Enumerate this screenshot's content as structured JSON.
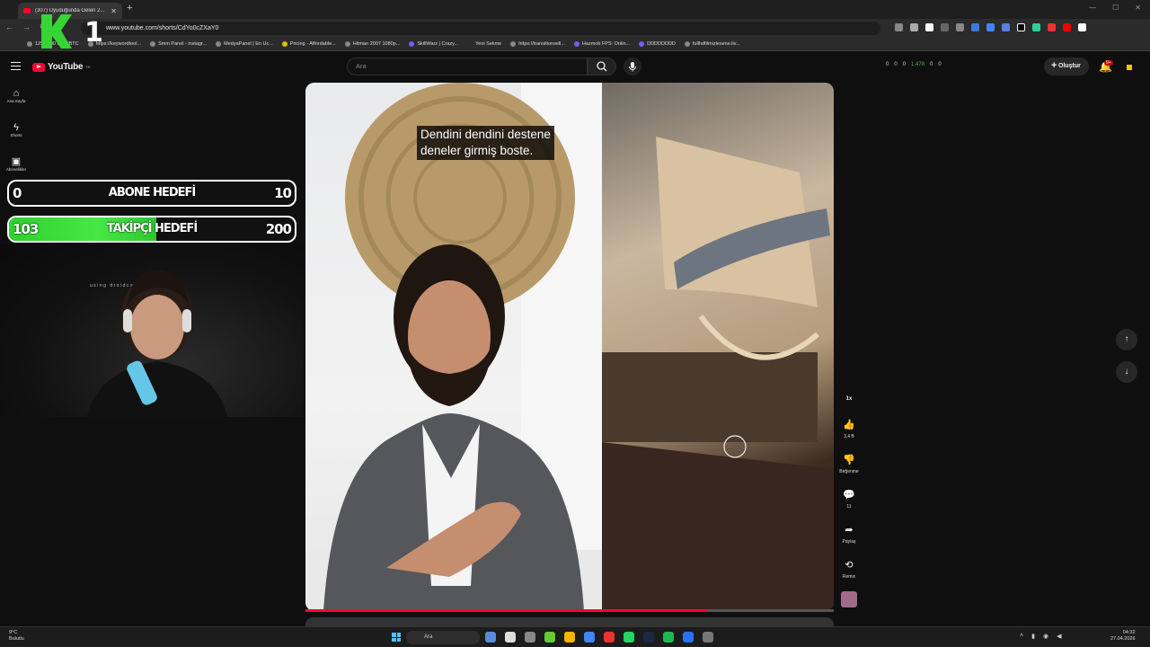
{
  "browser": {
    "tab_title": "(307) Uyuduğunda Gelen 2...",
    "url": "www.youtube.com/shorts/CdYo0cZXaY0",
    "bookmarks": [
      "12902,00 USD/BTC",
      "https://keywordtool...",
      "Smm Panel - instagr...",
      "MedyaPanel | En Uc...",
      "Pricing - Affordable...",
      "Hitman 2007 1080p...",
      "SkillWarz | Crazy...",
      "Yeni Sekme",
      "https://transitionsell...",
      "Hazmob FPS: Onlin...",
      "DDDDDDDD",
      "fullhdfilmizlesene.liv..."
    ]
  },
  "youtube": {
    "logo_text": "YouTube",
    "country_code": "TR",
    "search_placeholder": "Ara",
    "create_label": "Oluştur",
    "notif_badge": "9+",
    "header_stats": [
      "0",
      "0",
      "0",
      "1.478",
      "0",
      "0"
    ]
  },
  "sidebar": {
    "items": [
      {
        "label": "Ana Sayfa",
        "icon": "home-icon"
      },
      {
        "label": "Shorts",
        "icon": "shorts-icon"
      },
      {
        "label": "Abonelikler",
        "icon": "subscriptions-icon"
      }
    ]
  },
  "overlay": {
    "logo_text": "1",
    "abone": {
      "current": "0",
      "label": "ABONE HEDEFİ",
      "goal": "10",
      "progress": 0.0
    },
    "takipci": {
      "current": "103",
      "label": "TAKİPÇİ HEDEFİ",
      "goal": "200",
      "progress": 0.515
    },
    "webcam_watermark": "using droidcam app"
  },
  "video": {
    "caption_line1": "Dendini dendini destene",
    "caption_line2": "deneler girmiş boste.",
    "progress": 0.76
  },
  "actions": {
    "speed": "1x",
    "likes": "3,4 B",
    "dislike_label": "Beğenme",
    "comments": "11",
    "share_label": "Paylaş",
    "remix_label": "Remix"
  },
  "taskbar": {
    "weather_temp": "9°C",
    "weather_desc": "Bulutlu",
    "search_label": "Ara",
    "time": "04:32",
    "date": "27.04.2026"
  },
  "colors": {
    "accent_red": "#ff0033",
    "goal_green": "#46e846"
  }
}
